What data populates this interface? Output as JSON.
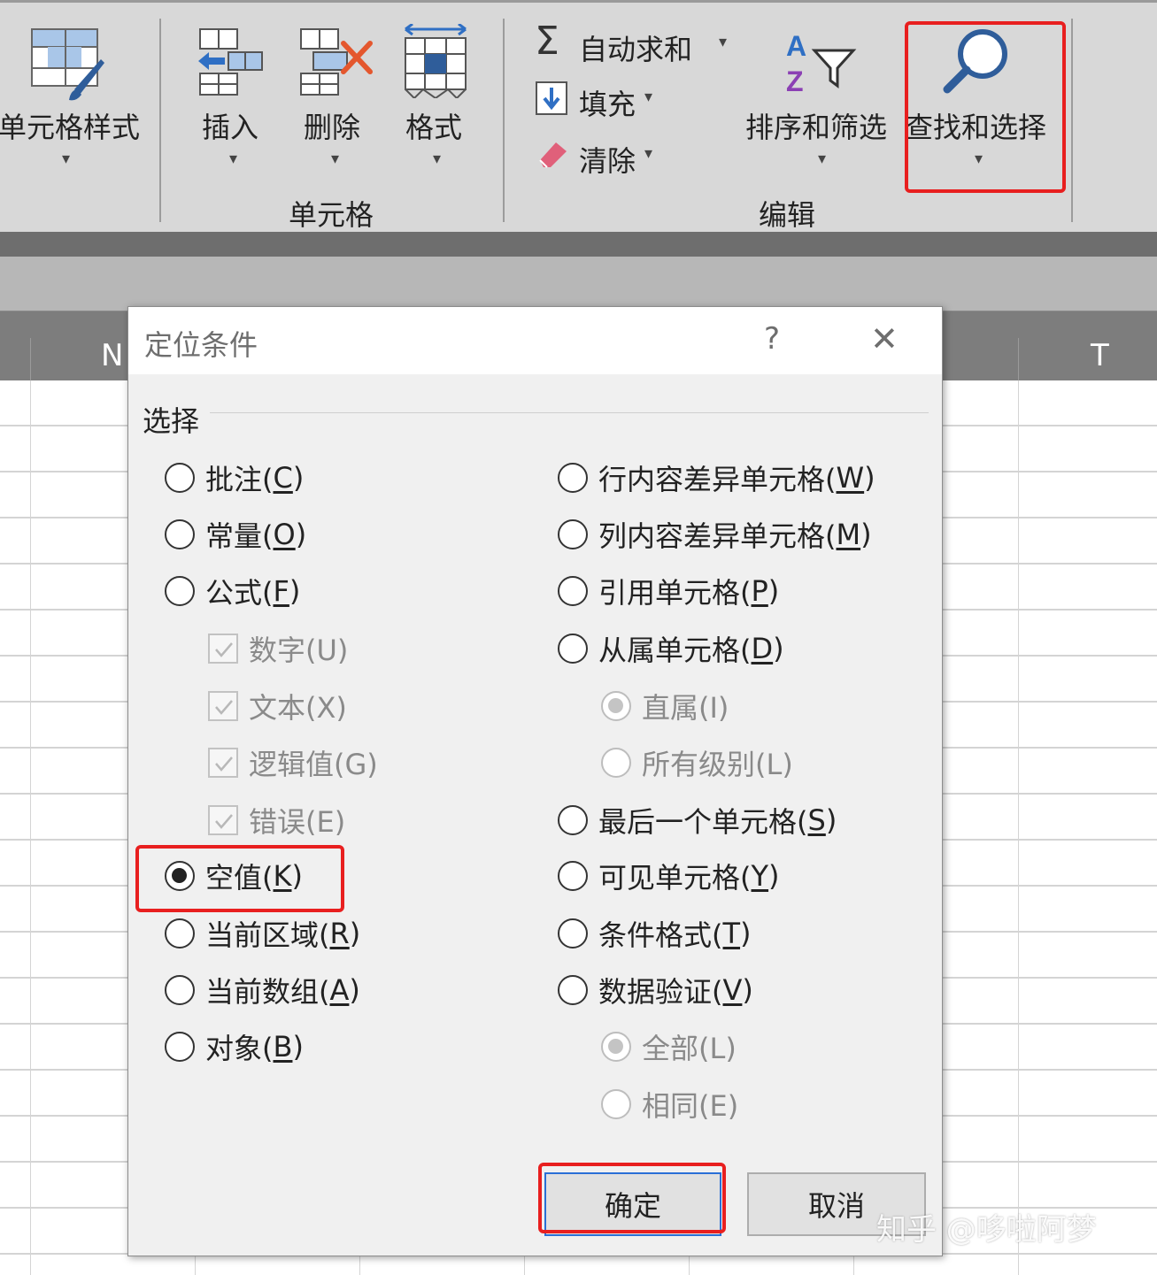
{
  "ribbon": {
    "cell_styles": "单元格样式",
    "insert": "插入",
    "delete": "删除",
    "format": "格式",
    "cells_group": "单元格",
    "autosum": "自动求和",
    "fill": "填充",
    "clear": "清除",
    "sort_filter": "排序和筛选",
    "find_select": "查找和选择",
    "editing_group": "编辑"
  },
  "sheet": {
    "columns": [
      "N",
      "T"
    ]
  },
  "dialog": {
    "title": "定位条件",
    "help": "?",
    "close": "✕",
    "section": "选择",
    "left_options": [
      {
        "label": "批注(",
        "key": "C",
        "end": ")"
      },
      {
        "label": "常量(",
        "key": "O",
        "end": ")"
      },
      {
        "label": "公式(",
        "key": "F",
        "end": ")"
      },
      {
        "label": "数字(U)"
      },
      {
        "label": "文本(X)"
      },
      {
        "label": "逻辑值(G)"
      },
      {
        "label": "错误(E)"
      },
      {
        "label": "空值(",
        "key": "K",
        "end": ")"
      },
      {
        "label": "当前区域(",
        "key": "R",
        "end": ")"
      },
      {
        "label": "当前数组(",
        "key": "A",
        "end": ")"
      },
      {
        "label": "对象(",
        "key": "B",
        "end": ")"
      }
    ],
    "right_options": [
      {
        "label": "行内容差异单元格(",
        "key": "W",
        "end": ")"
      },
      {
        "label": "列内容差异单元格(",
        "key": "M",
        "end": ")"
      },
      {
        "label": "引用单元格(",
        "key": "P",
        "end": ")"
      },
      {
        "label": "从属单元格(",
        "key": "D",
        "end": ")"
      },
      {
        "label": "直属(I)"
      },
      {
        "label": "所有级别(L)"
      },
      {
        "label": "最后一个单元格(",
        "key": "S",
        "end": ")"
      },
      {
        "label": "可见单元格(",
        "key": "Y",
        "end": ")"
      },
      {
        "label": "条件格式(",
        "key": "T",
        "end": ")"
      },
      {
        "label": "数据验证(",
        "key": "V",
        "end": ")"
      },
      {
        "label": "全部(L)"
      },
      {
        "label": "相同(E)"
      }
    ],
    "selected_option": "空值",
    "ok": "确定",
    "cancel": "取消"
  },
  "watermark": "知乎 @哆啦阿梦",
  "colors": {
    "highlight": "#e81f1f",
    "ribbon_bg": "#d8d8d8",
    "dialog_bg": "#f0f0f0",
    "accent_blue": "#2a6fd6"
  }
}
